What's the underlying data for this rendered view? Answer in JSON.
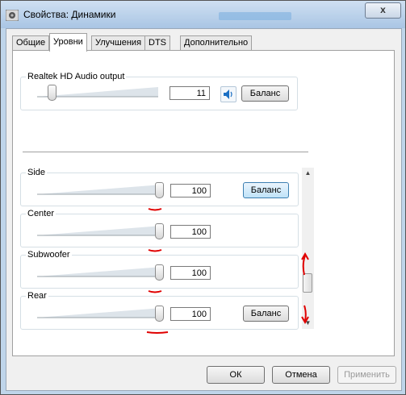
{
  "window": {
    "title": "Свойства: Динамики",
    "close_label": "x"
  },
  "tabs": [
    {
      "label": "Общие"
    },
    {
      "label": "Уровни"
    },
    {
      "label": "Улучшения"
    },
    {
      "label": "DTS"
    },
    {
      "label": "Дополнительно"
    }
  ],
  "active_tab": "Уровни",
  "master": {
    "label": "Realtek HD Audio output",
    "value": "11",
    "level": 0.11,
    "balance_label": "Баланс"
  },
  "channels": [
    {
      "label": "Side",
      "value": "100",
      "level": 1.0,
      "balance_label": "Баланс",
      "balance_hover": true
    },
    {
      "label": "Center",
      "value": "100",
      "level": 1.0
    },
    {
      "label": "Subwoofer",
      "value": "100",
      "level": 1.0
    },
    {
      "label": "Rear",
      "value": "100",
      "level": 1.0,
      "balance_label": "Баланс"
    }
  ],
  "footer": {
    "ok_label": "ОК",
    "cancel_label": "Отмена",
    "apply_label": "Применить"
  },
  "colors": {
    "annotation": "#e00000",
    "accent": "#3c7fb1",
    "speaker": "#1a6fc4"
  }
}
